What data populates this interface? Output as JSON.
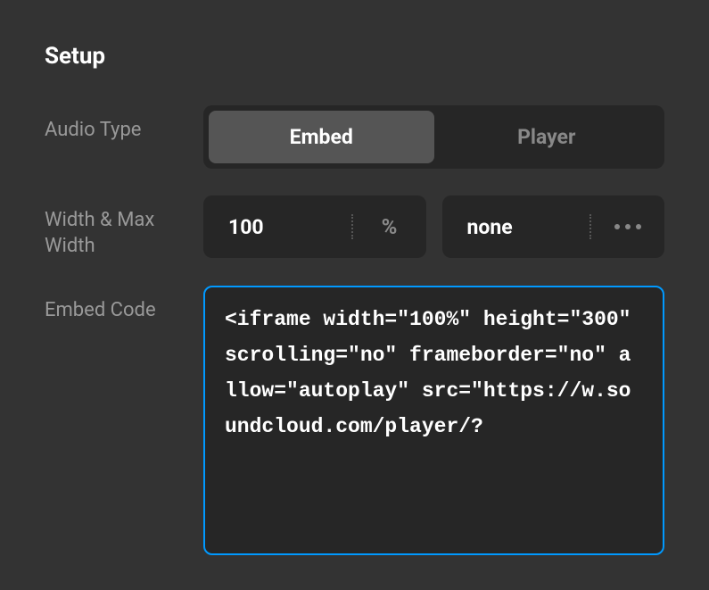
{
  "section": {
    "title": "Setup"
  },
  "audioType": {
    "label": "Audio Type",
    "options": [
      "Embed",
      "Player"
    ],
    "selected": "Embed"
  },
  "width": {
    "label": "Width & Max Width",
    "value": "100",
    "unit": "%",
    "maxValue": "none"
  },
  "embed": {
    "label": "Embed Code",
    "code": "<iframe width=\"100%\" height=\"300\" scrolling=\"no\" frameborder=\"no\" allow=\"autoplay\" src=\"https://w.soundcloud.com/player/?"
  }
}
